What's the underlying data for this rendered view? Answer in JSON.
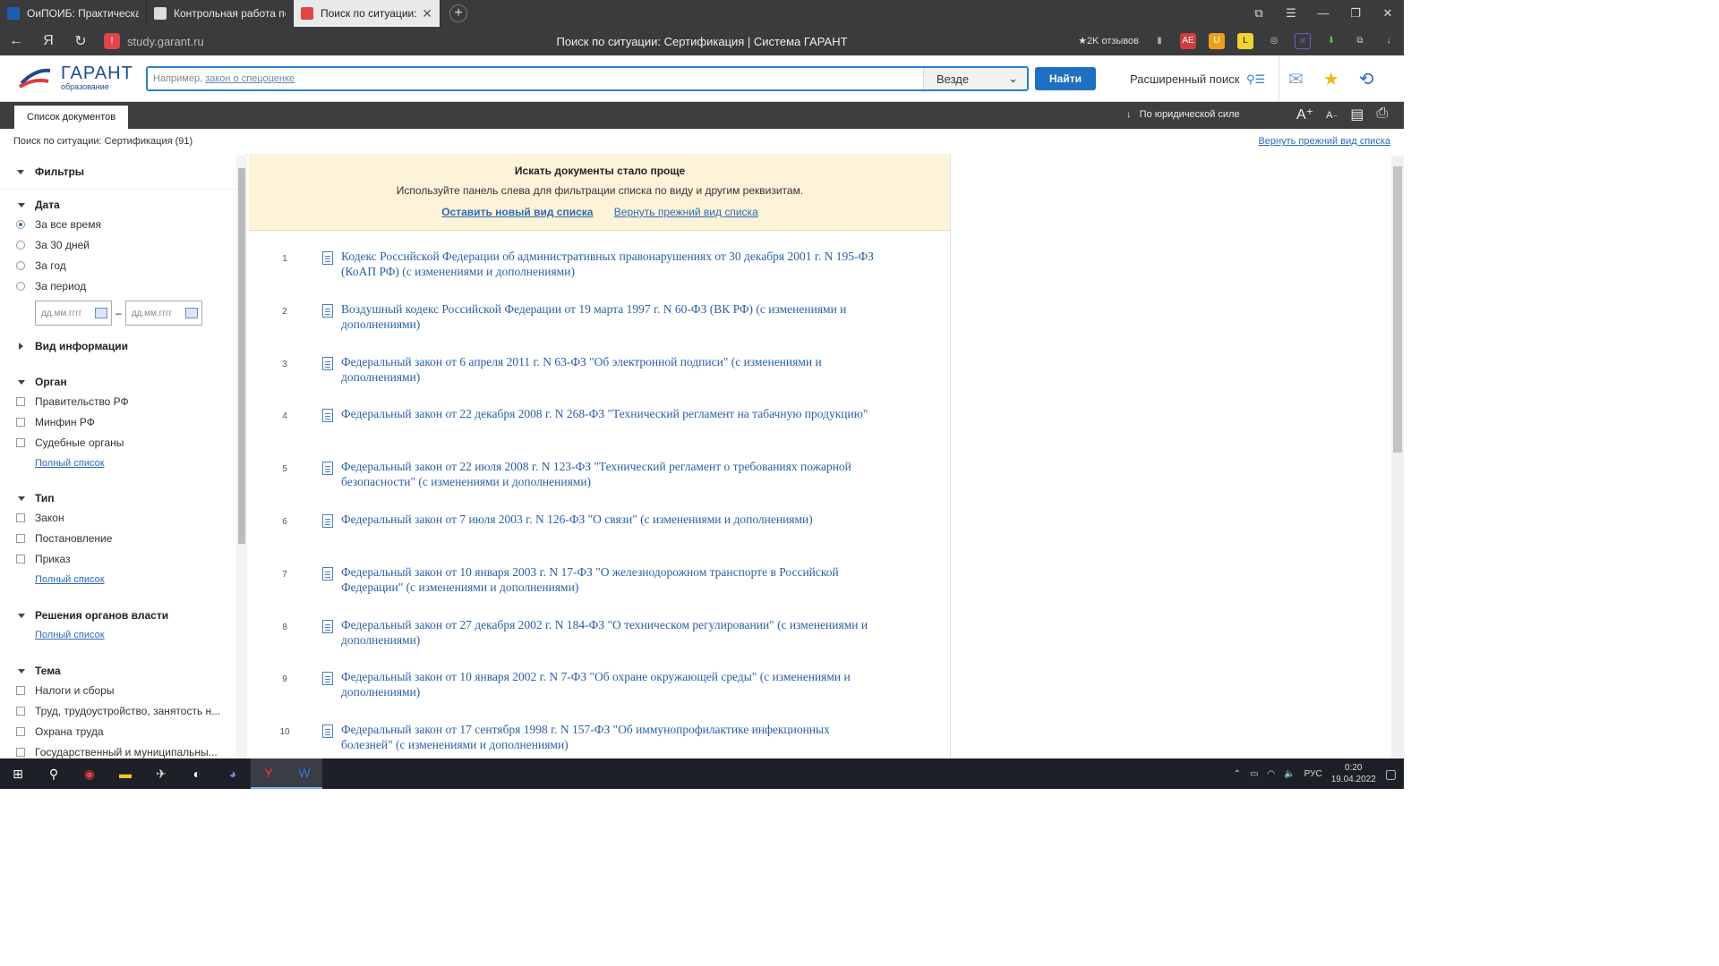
{
  "browser": {
    "tabs": [
      {
        "title": "ОиПОИБ: Практическая р",
        "icon_color": "#1a5fb4"
      },
      {
        "title": "Контрольная работа по С",
        "icon_color": "#d9d9d9"
      },
      {
        "title": "Поиск по ситуации: Се",
        "icon_color": "#e24545",
        "active": true
      }
    ],
    "url": "study.garant.ru",
    "page_title": "Поиск по ситуации: Сертификация | Система ГАРАНТ",
    "reviews": "★2K отзывов"
  },
  "header": {
    "logo_main": "ГАРАНТ",
    "logo_sub": "образование",
    "search_placeholder_prefix": "Например, ",
    "search_placeholder_link": "закон о спецоценке",
    "scope": "Везде",
    "find_button": "Найти",
    "advanced_search": "Расширенный поиск"
  },
  "toolbar": {
    "doc_tab": "Список документов",
    "sort_label": "По юридической силе"
  },
  "subheader": {
    "query": "Поиск по ситуации: Сертификация (91)",
    "restore_link": "Вернуть прежний вид списка"
  },
  "sidebar": {
    "filters_title": "Фильтры",
    "date": {
      "title": "Дата",
      "options": [
        "За все время",
        "За 30 дней",
        "За год",
        "За период"
      ],
      "date_placeholder": "дд.мм.гггг",
      "dash": "–"
    },
    "info_type": "Вид информации",
    "organ": {
      "title": "Орган",
      "options": [
        "Правительство РФ",
        "Минфин РФ",
        "Судебные органы"
      ],
      "full_list": "Полный список"
    },
    "type": {
      "title": "Тип",
      "options": [
        "Закон",
        "Постановление",
        "Приказ"
      ],
      "full_list": "Полный список"
    },
    "decisions": {
      "title": "Решения органов власти",
      "full_list": "Полный список"
    },
    "topic": {
      "title": "Тема",
      "options": [
        "Налоги и сборы",
        "Труд, трудоустройство, занятость н...",
        "Охрана труда",
        "Государственный и муниципальны..."
      ]
    }
  },
  "notice": {
    "title": "Искать документы стало проще",
    "text": "Используйте панель слева для фильтрации списка по виду и другим реквизитам.",
    "link_new": "Оставить новый вид списка",
    "link_old": "Вернуть прежний вид списка"
  },
  "documents": [
    {
      "num": "1",
      "title": "Кодекс Российской Федерации об административных правонарушениях от 30 декабря 2001 г. N 195-ФЗ (КоАП РФ) (с изменениями и дополнениями)"
    },
    {
      "num": "2",
      "title": "Воздушный кодекс Российской Федерации от 19 марта 1997 г. N 60-ФЗ (ВК РФ) (с изменениями и дополнениями)"
    },
    {
      "num": "3",
      "title": "Федеральный закон от 6 апреля 2011 г. N 63-ФЗ \"Об электронной подписи\" (с изменениями и дополнениями)"
    },
    {
      "num": "4",
      "title": "Федеральный закон от 22 декабря 2008 г. N 268-ФЗ \"Технический регламент на табачную продукцию\""
    },
    {
      "num": "5",
      "title": "Федеральный закон от 22 июля 2008 г. N 123-ФЗ \"Технический регламент о требованиях пожарной безопасности\" (с изменениями и дополнениями)"
    },
    {
      "num": "6",
      "title": "Федеральный закон от 7 июля 2003 г. N 126-ФЗ \"О связи\" (с изменениями и дополнениями)"
    },
    {
      "num": "7",
      "title": "Федеральный закон от 10 января 2003 г. N 17-ФЗ \"О железнодорожном транспорте в Российской Федерации\" (с изменениями и дополнениями)"
    },
    {
      "num": "8",
      "title": "Федеральный закон от 27 декабря 2002 г. N 184-ФЗ \"О техническом регулировании\" (с изменениями и дополнениями)"
    },
    {
      "num": "9",
      "title": "Федеральный закон от 10 января 2002 г. N 7-ФЗ \"Об охране окружающей среды\" (с изменениями и дополнениями)"
    },
    {
      "num": "10",
      "title": "Федеральный закон от 17 сентября 1998 г. N 157-ФЗ \"Об иммунопрофилактике инфекционных болезней\" (с изменениями и дополнениями)"
    }
  ],
  "taskbar": {
    "lang": "РУС",
    "time": "0:20",
    "date": "19.04.2022"
  }
}
